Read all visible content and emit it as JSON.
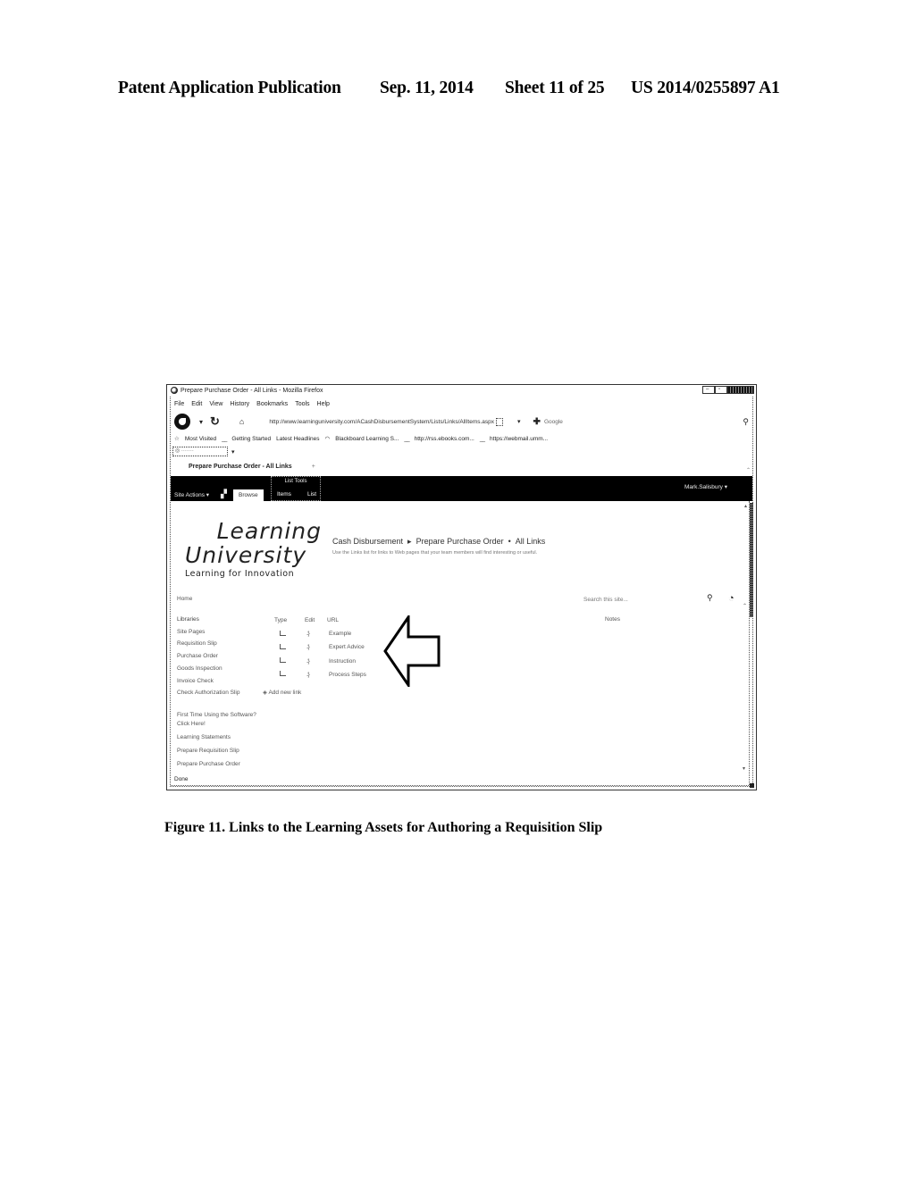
{
  "patent_header": {
    "publication": "Patent Application Publication",
    "date": "Sep. 11, 2014",
    "sheet": "Sheet 11 of 25",
    "number": "US 2014/0255897 A1"
  },
  "figure_caption": "Figure 11.  Links to the Learning Assets for Authoring a Requisition Slip",
  "browser": {
    "window_title": "Prepare Purchase Order - All Links - Mozilla Firefox",
    "menu": [
      "File",
      "Edit",
      "View",
      "History",
      "Bookmarks",
      "Tools",
      "Help"
    ],
    "url": "http://www.learninguniversity.com/ACashDisbursementSystem/Lists/Links/AllItems.aspx",
    "search_engine_placeholder": "Google",
    "bookmarks": [
      "Most Visited",
      "Getting Started",
      "Latest Headlines",
      "Blackboard Learning S...",
      "http://rss.ebooks.com...",
      "https://webmail.umm..."
    ],
    "tab_title": "Prepare Purchase Order - All Links",
    "status": "Done"
  },
  "ribbon": {
    "site_actions": "Site Actions ▾",
    "browse": "Browse",
    "list_tools": "List Tools",
    "items": "Items",
    "list": "List",
    "user": "Mark.Salisbury ▾"
  },
  "logo": {
    "line1": "Learning",
    "line2": "University",
    "tagline": "Learning for Innovation"
  },
  "page": {
    "breadcrumb": [
      "Cash Disbursement",
      "Prepare Purchase Order",
      "All Links"
    ],
    "breadcrumb_sep": "▸",
    "breadcrumb_sep2": "•",
    "description": "Use the Links list for links to Web pages that your team members will find interesting or useful.",
    "home": "Home",
    "search_placeholder": "Search this site...",
    "add_link": "Add new link"
  },
  "quicklaunch": {
    "heading": "Libraries",
    "items": [
      "Site Pages",
      "Requisition Slip",
      "Purchase Order",
      "Goods Inspection",
      "Invoice Check",
      "Check Authorization Slip"
    ],
    "secondary": [
      "First Time Using the Software? Click Here!",
      "Learning Statements",
      "Prepare Requisition Slip",
      "Prepare Purchase Order"
    ]
  },
  "links_list": {
    "columns": [
      "Type",
      "Edit",
      "URL",
      "Notes"
    ],
    "rows": [
      {
        "url": "Example"
      },
      {
        "url": "Expert Advice"
      },
      {
        "url": "Instruction"
      },
      {
        "url": "Process Steps"
      }
    ]
  }
}
